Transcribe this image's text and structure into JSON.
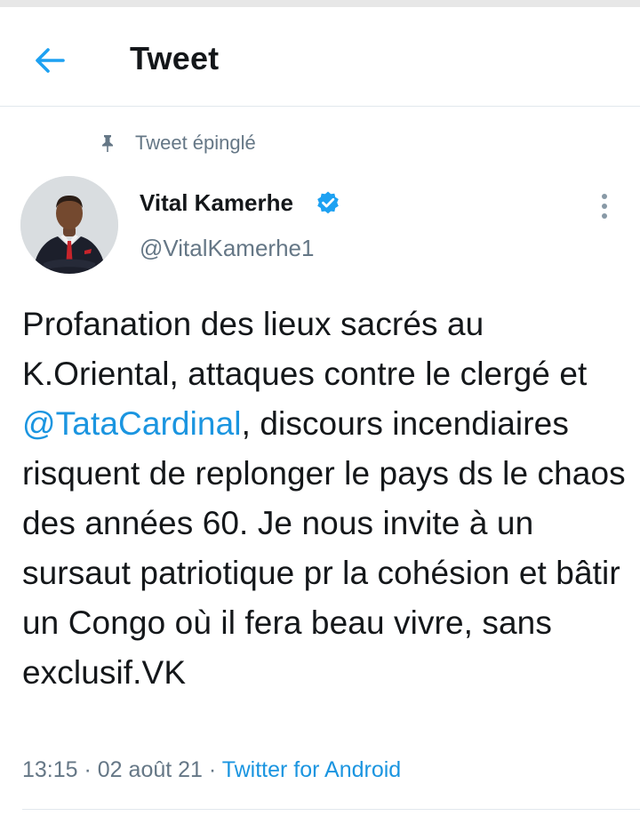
{
  "header": {
    "title": "Tweet",
    "back_icon": "back-arrow-icon"
  },
  "pinned": {
    "label": "Tweet épinglé",
    "icon": "pin-icon"
  },
  "author": {
    "name": "Vital Kamerhe",
    "handle": "@VitalKamerhe1",
    "verified_icon": "verified-badge-icon"
  },
  "tweet": {
    "text_before_mention": "Profanation des lieux sacrés au K.Oriental, attaques contre le clergé et ",
    "mention": "@TataCardinal",
    "text_after_mention": ", discours incendiaires risquent de replonger le pays ds le chaos des années 60. Je nous invite à un sursaut patriotique pr la cohésion et bâtir un Congo où il fera beau vivre, sans exclusif.VK"
  },
  "meta": {
    "time": "13:15",
    "separator": " · ",
    "date": "02 août 21",
    "source": "Twitter for Android"
  },
  "colors": {
    "accent": "#1b95e0",
    "secondary_text": "#657786",
    "primary_text": "#14171a"
  }
}
